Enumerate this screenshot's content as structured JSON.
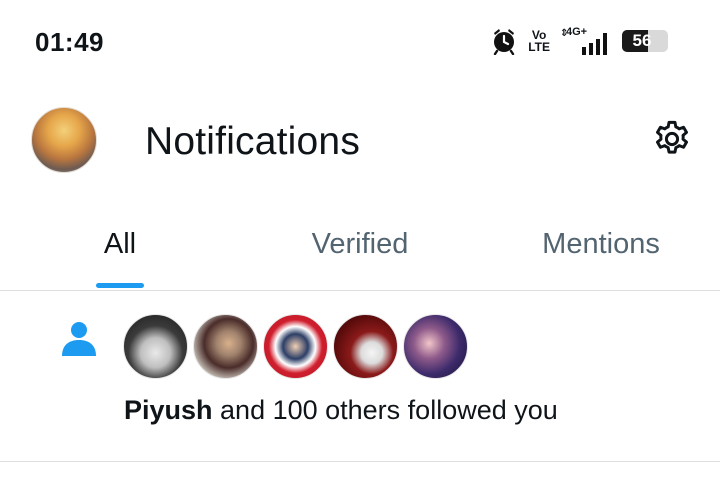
{
  "status_bar": {
    "time": "01:49",
    "volte_top": "Vo",
    "volte_bottom": "LTE",
    "network": "4G+",
    "battery_level": "56",
    "battery_fraction": 0.56,
    "icons": [
      "alarm-icon",
      "volte-icon",
      "signal-icon",
      "battery-icon"
    ]
  },
  "header": {
    "title": "Notifications",
    "settings_icon": "gear-icon"
  },
  "tabs": [
    {
      "label": "All",
      "active": true
    },
    {
      "label": "Verified",
      "active": false
    },
    {
      "label": "Mentions",
      "active": false
    }
  ],
  "notification": {
    "icon": "person-icon",
    "actor": "Piyush",
    "rest": " and 100 others followed you",
    "avatar_count": 5
  },
  "colors": {
    "accent": "#1d9bf0",
    "text_primary": "#0f1419",
    "text_secondary": "#536471",
    "divider": "#dcdfe2"
  }
}
